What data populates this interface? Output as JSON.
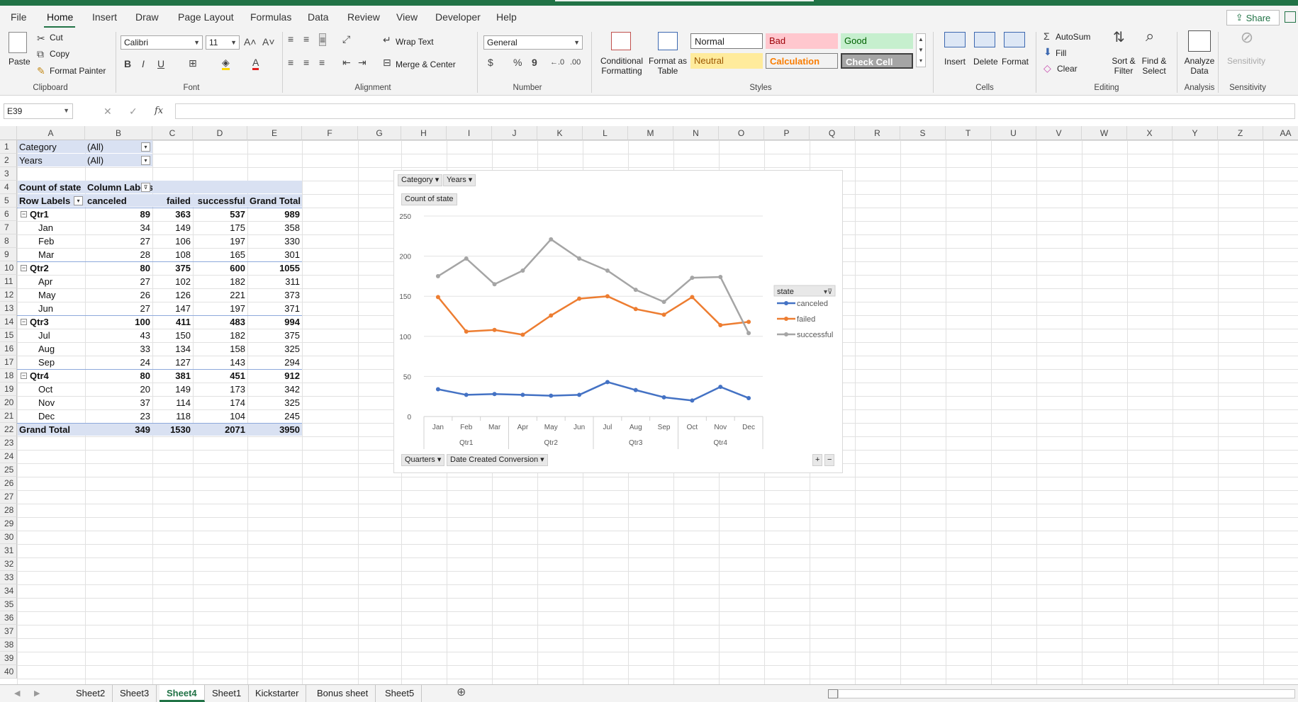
{
  "ribbon_tabs": [
    "File",
    "Home",
    "Insert",
    "Draw",
    "Page Layout",
    "Formulas",
    "Data",
    "Review",
    "View",
    "Developer",
    "Help"
  ],
  "share_label": "Share",
  "clipboard": {
    "paste": "Paste",
    "cut": "Cut",
    "copy": "Copy",
    "format_painter": "Format Painter",
    "group": "Clipboard"
  },
  "font": {
    "name": "Calibri",
    "size": "11",
    "group": "Font",
    "bold": "B",
    "italic": "I",
    "underline": "U"
  },
  "alignment": {
    "wrap_text": "Wrap Text",
    "merge_center": "Merge & Center",
    "group": "Alignment"
  },
  "number": {
    "format": "General",
    "group": "Number",
    "currency": "$",
    "percent": "%",
    "comma": "9"
  },
  "styles": {
    "conditional": "Conditional Formatting",
    "format_as_table": "Format as Table",
    "cells": [
      "Normal",
      "Bad",
      "Good",
      "Neutral",
      "Calculation",
      "Check Cell"
    ],
    "group": "Styles"
  },
  "cells_grp": {
    "insert": "Insert",
    "delete": "Delete",
    "format": "Format",
    "group": "Cells"
  },
  "editing": {
    "autosum": "AutoSum",
    "fill": "Fill",
    "clear": "Clear",
    "sort_filter": "Sort & Filter",
    "find_select": "Find & Select",
    "group": "Editing"
  },
  "analysis": {
    "analyze": "Analyze Data",
    "group": "Analysis"
  },
  "sensitivity": {
    "label": "Sensitivity",
    "group": "Sensitivity"
  },
  "name_box": "E39",
  "formula_value": "",
  "columns": [
    "A",
    "B",
    "C",
    "D",
    "E",
    "F",
    "G",
    "H",
    "I",
    "J",
    "K",
    "L",
    "M",
    "N",
    "O",
    "P",
    "Q",
    "R",
    "S",
    "T",
    "U",
    "V",
    "W",
    "X",
    "Y",
    "Z",
    "AA"
  ],
  "rows": [
    "1",
    "2",
    "3",
    "4",
    "5",
    "6",
    "7",
    "8",
    "9",
    "10",
    "11",
    "12",
    "13",
    "14",
    "15",
    "16",
    "17",
    "18",
    "19",
    "20",
    "21",
    "22",
    "23",
    "24",
    "25",
    "26",
    "27",
    "28",
    "29",
    "30",
    "31",
    "32",
    "33",
    "34",
    "35",
    "36",
    "37",
    "38",
    "39",
    "40"
  ],
  "pivot": {
    "filters": [
      [
        "Category",
        "(All)"
      ],
      [
        "Years",
        "(All)"
      ]
    ],
    "header_row1": [
      "Count of state",
      "Column Labels"
    ],
    "header_row2": [
      "Row Labels",
      "canceled",
      "failed",
      "successful",
      "Grand Total"
    ],
    "body": [
      {
        "label": "Qtr1",
        "type": "qtr",
        "v": [
          "89",
          "363",
          "537",
          "989"
        ]
      },
      {
        "label": "Jan",
        "type": "month",
        "v": [
          "34",
          "149",
          "175",
          "358"
        ]
      },
      {
        "label": "Feb",
        "type": "month",
        "v": [
          "27",
          "106",
          "197",
          "330"
        ]
      },
      {
        "label": "Mar",
        "type": "month",
        "v": [
          "28",
          "108",
          "165",
          "301"
        ]
      },
      {
        "label": "Qtr2",
        "type": "qtr",
        "v": [
          "80",
          "375",
          "600",
          "1055"
        ]
      },
      {
        "label": "Apr",
        "type": "month",
        "v": [
          "27",
          "102",
          "182",
          "311"
        ]
      },
      {
        "label": "May",
        "type": "month",
        "v": [
          "26",
          "126",
          "221",
          "373"
        ]
      },
      {
        "label": "Jun",
        "type": "month",
        "v": [
          "27",
          "147",
          "197",
          "371"
        ]
      },
      {
        "label": "Qtr3",
        "type": "qtr",
        "v": [
          "100",
          "411",
          "483",
          "994"
        ]
      },
      {
        "label": "Jul",
        "type": "month",
        "v": [
          "43",
          "150",
          "182",
          "375"
        ]
      },
      {
        "label": "Aug",
        "type": "month",
        "v": [
          "33",
          "134",
          "158",
          "325"
        ]
      },
      {
        "label": "Sep",
        "type": "month",
        "v": [
          "24",
          "127",
          "143",
          "294"
        ]
      },
      {
        "label": "Qtr4",
        "type": "qtr",
        "v": [
          "80",
          "381",
          "451",
          "912"
        ]
      },
      {
        "label": "Oct",
        "type": "month",
        "v": [
          "20",
          "149",
          "173",
          "342"
        ]
      },
      {
        "label": "Nov",
        "type": "month",
        "v": [
          "37",
          "114",
          "174",
          "325"
        ]
      },
      {
        "label": "Dec",
        "type": "month",
        "v": [
          "23",
          "118",
          "104",
          "245"
        ]
      },
      {
        "label": "Grand Total",
        "type": "total",
        "v": [
          "349",
          "1530",
          "2071",
          "3950"
        ]
      }
    ]
  },
  "chart_data": {
    "type": "line",
    "title": "",
    "filter_buttons": [
      "Category",
      "Years"
    ],
    "value_field": "Count of state",
    "axis_buttons": [
      "Quarters",
      "Date Created Conversion"
    ],
    "legend_title": "state",
    "legend_position": "right",
    "categories": [
      "Jan",
      "Feb",
      "Mar",
      "Apr",
      "May",
      "Jun",
      "Jul",
      "Aug",
      "Sep",
      "Oct",
      "Nov",
      "Dec"
    ],
    "groups": [
      "Qtr1",
      "Qtr2",
      "Qtr3",
      "Qtr4"
    ],
    "y_ticks": [
      "250",
      "200",
      "150",
      "100",
      "50",
      "0"
    ],
    "ylim": [
      0,
      250
    ],
    "grid": true,
    "series": [
      {
        "name": "canceled",
        "color": "#4472c4",
        "values": [
          34,
          27,
          28,
          27,
          26,
          27,
          43,
          33,
          24,
          20,
          37,
          23
        ]
      },
      {
        "name": "failed",
        "color": "#ed7d31",
        "values": [
          149,
          106,
          108,
          102,
          126,
          147,
          150,
          134,
          127,
          149,
          114,
          118
        ]
      },
      {
        "name": "successful",
        "color": "#a5a5a5",
        "values": [
          175,
          197,
          165,
          182,
          221,
          197,
          182,
          158,
          143,
          173,
          174,
          104
        ]
      }
    ]
  },
  "sheet_tabs": [
    "Sheet2",
    "Sheet3",
    "Sheet4",
    "Sheet1",
    "Kickstarter",
    "Bonus sheet",
    "Sheet5"
  ],
  "active_sheet": "Sheet4",
  "colors": {
    "accent": "#217346",
    "header_bg": "#d9e1f2"
  }
}
